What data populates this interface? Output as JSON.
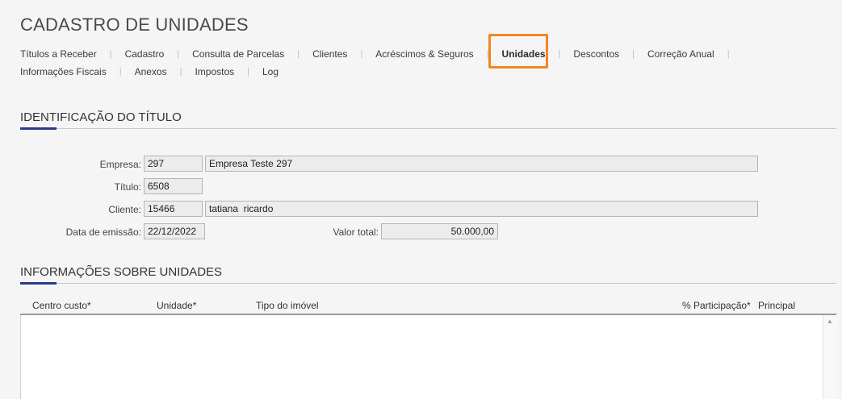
{
  "page": {
    "title": "CADASTRO DE UNIDADES"
  },
  "tabs": {
    "row1": [
      "Títulos a Receber",
      "Cadastro",
      "Consulta de Parcelas",
      "Clientes",
      "Acréscimos & Seguros",
      "Unidades",
      "Descontos",
      "Correção Anual"
    ],
    "row2": [
      "Informações Fiscais",
      "Anexos",
      "Impostos",
      "Log"
    ],
    "active": "Unidades",
    "highlight_color": "#f5851f"
  },
  "ident": {
    "title": "IDENTIFICAÇÃO DO TÍTULO",
    "empresa_label": "Empresa:",
    "empresa_code": "297",
    "empresa_name": "Empresa Teste 297",
    "titulo_label": "Título:",
    "titulo_value": "6508",
    "cliente_label": "Cliente:",
    "cliente_code": "15466",
    "cliente_name": "tatiana  ricardo",
    "data_label": "Data de emissão:",
    "data_value": "22/12/2022",
    "valor_label": "Valor total:",
    "valor_value": "50.000,00"
  },
  "units": {
    "title": "INFORMAÇÕES SOBRE UNIDADES",
    "columns": [
      "Centro custo*",
      "Unidade*",
      "Tipo do imóvel",
      "% Participação*",
      "Principal"
    ],
    "rows": []
  },
  "colors": {
    "accent": "#2a3a8c"
  }
}
